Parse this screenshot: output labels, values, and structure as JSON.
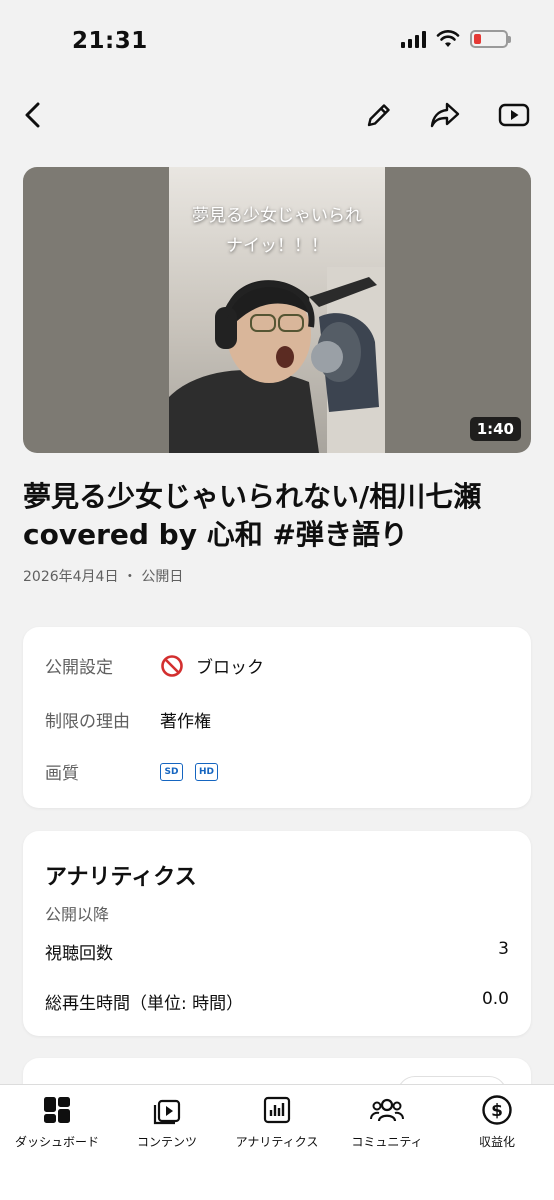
{
  "status_bar": {
    "time": "21:31"
  },
  "header": {
    "back_icon": "chevron-left-icon",
    "edit_icon": "pencil-icon",
    "share_icon": "share-icon",
    "youtube_icon": "youtube-icon"
  },
  "video": {
    "thumbnail_caption_line1": "夢見る少女じゃいられ",
    "thumbnail_caption_line2": "ナイッ！！！",
    "duration": "1:40",
    "title": "夢見る少女じゃいられない/相川七瀬 covered by 心和 #弾き語り",
    "date": "2026年4月4日",
    "date_suffix": "・ 公開日"
  },
  "details": {
    "visibility_label": "公開設定",
    "visibility_value": "ブロック",
    "visibility_icon": "blocked-icon",
    "restriction_label": "制限の理由",
    "restriction_value": "著作権",
    "quality_label": "画質",
    "quality_badges": [
      "SD",
      "HD"
    ],
    "status_color": "#d32f2f",
    "badge_color": "#1565c0"
  },
  "analytics": {
    "title": "アナリティクス",
    "subtitle": "公開以降",
    "views_label": "視聴回数",
    "views_value": "3",
    "watch_time_label": "総再生時間（単位: 時間）",
    "watch_time_value": "0.0"
  },
  "bottom_nav": {
    "items": [
      {
        "label": "ダッシュボード",
        "icon": "dashboard-icon"
      },
      {
        "label": "コンテンツ",
        "icon": "content-icon"
      },
      {
        "label": "アナリティクス",
        "icon": "analytics-icon"
      },
      {
        "label": "コミュニティ",
        "icon": "community-icon"
      },
      {
        "label": "収益化",
        "icon": "dollar-icon"
      }
    ]
  }
}
